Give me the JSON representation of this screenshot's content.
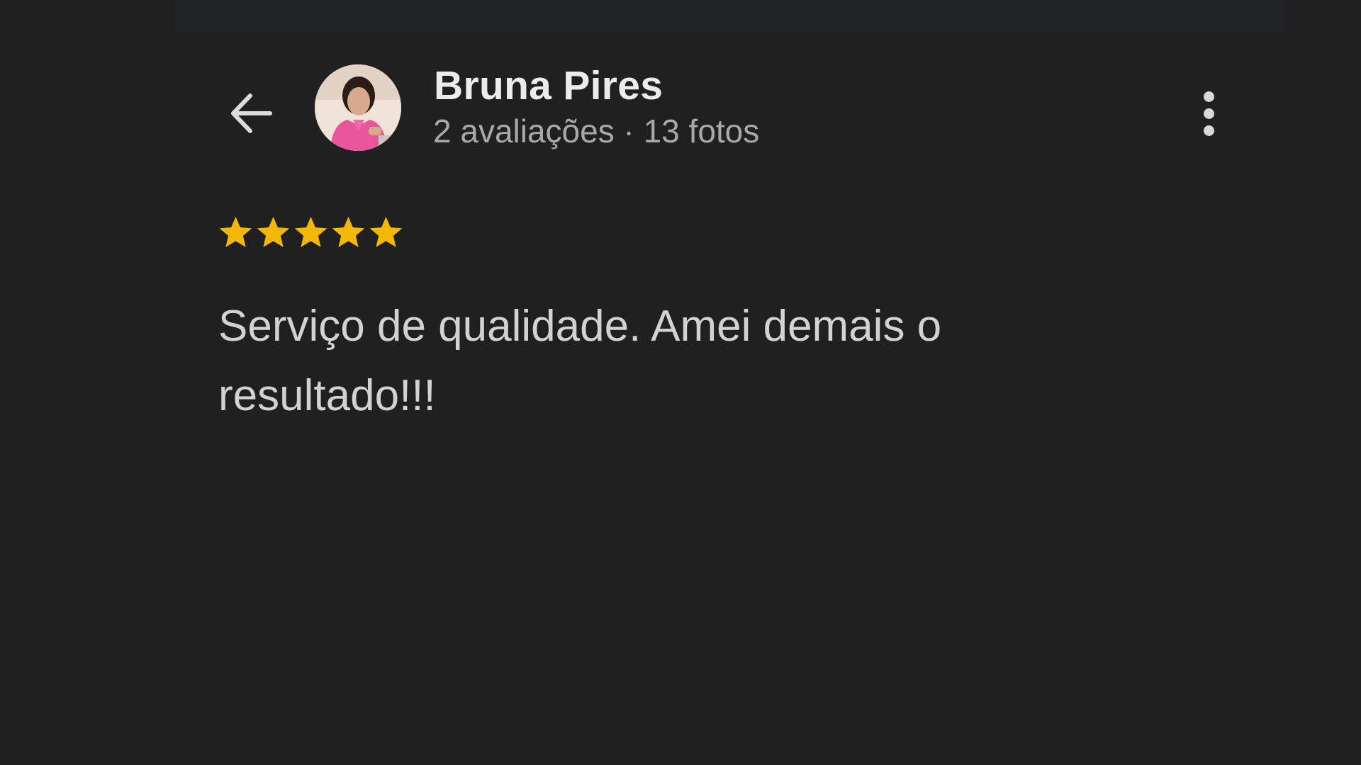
{
  "reviewer": {
    "name": "Bruna Pires",
    "meta": "2 avaliações · 13 fotos"
  },
  "review": {
    "rating": 5,
    "max_rating": 5,
    "text": "Serviço de qualidade. Amei demais o resultado!!!"
  },
  "icons": {
    "back": "arrow-left-icon",
    "more": "more-vert-icon",
    "star": "star-icon"
  },
  "colors": {
    "background": "#202020",
    "star": "#f5b800",
    "name_text": "#ececec",
    "meta_text": "#a9a9a9",
    "body_text": "#d2d2d2"
  }
}
